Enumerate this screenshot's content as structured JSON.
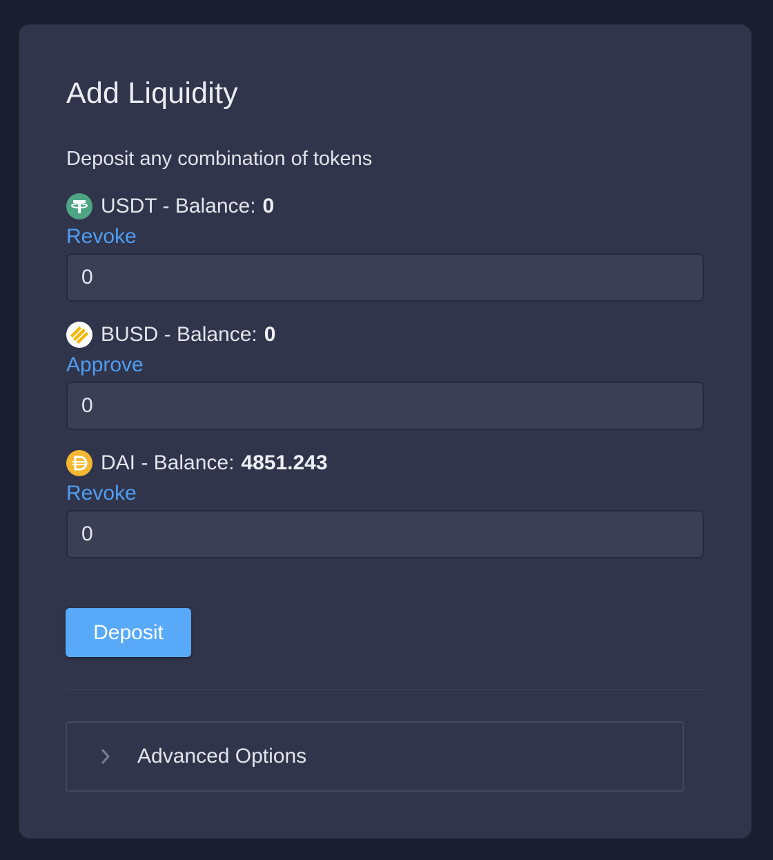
{
  "card": {
    "title": "Add Liquidity",
    "subtitle": "Deposit any combination of tokens"
  },
  "tokens": [
    {
      "symbol": "USDT",
      "label": "USDT - Balance:",
      "balance": "0",
      "action": "Revoke",
      "amount": "0",
      "icon": "usdt-icon",
      "icon_color": "#4ea584"
    },
    {
      "symbol": "BUSD",
      "label": "BUSD - Balance:",
      "balance": "0",
      "action": "Approve",
      "amount": "0",
      "icon": "busd-icon",
      "icon_color": "#f0b90b"
    },
    {
      "symbol": "DAI",
      "label": "DAI - Balance:",
      "balance": "4851.243",
      "action": "Revoke",
      "amount": "0",
      "icon": "dai-icon",
      "icon_color": "#f4b731"
    }
  ],
  "deposit_button": "Deposit",
  "advanced": {
    "label": "Advanced Options",
    "icon": "chevron-right-icon"
  },
  "colors": {
    "background": "#1b1e2e",
    "card": "#31354b",
    "accent": "#58a9f8",
    "link": "#4f9ef2"
  }
}
